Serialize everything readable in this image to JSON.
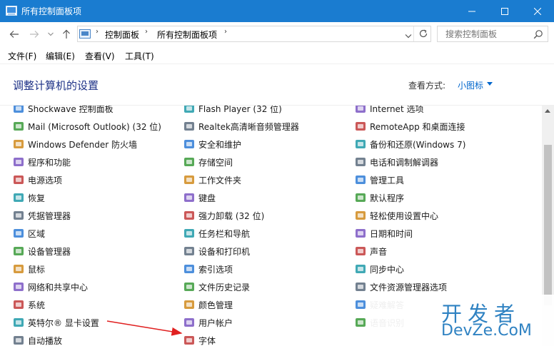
{
  "window": {
    "title": "所有控制面板项",
    "minimize_glyph": "—",
    "maximize_glyph": "☐",
    "close_glyph": "✕"
  },
  "address": {
    "crumbs": [
      "控制面板",
      "所有控制面板项"
    ],
    "separator": "›",
    "dropdown_glyph": "⌄",
    "refresh_glyph": "↻"
  },
  "search": {
    "placeholder": "搜索控制面板"
  },
  "menu": {
    "file": "文件(F)",
    "edit": "编辑(E)",
    "view": "查看(V)",
    "tools": "工具(T)"
  },
  "heading": "调整计算机的设置",
  "view_by": {
    "label": "查看方式:",
    "value": "小图标"
  },
  "columns": [
    {
      "items": [
        {
          "label": "Shockwave 控制面板",
          "icon": "shockwave-icon",
          "partial": true
        },
        {
          "label": "Mail (Microsoft Outlook) (32 位)",
          "icon": "mail-icon"
        },
        {
          "label": "Windows Defender 防火墙",
          "icon": "firewall-icon"
        },
        {
          "label": "程序和功能",
          "icon": "programs-icon"
        },
        {
          "label": "电源选项",
          "icon": "power-icon"
        },
        {
          "label": "恢复",
          "icon": "recovery-icon"
        },
        {
          "label": "凭据管理器",
          "icon": "credential-icon"
        },
        {
          "label": "区域",
          "icon": "region-icon"
        },
        {
          "label": "设备管理器",
          "icon": "device-manager-icon"
        },
        {
          "label": "鼠标",
          "icon": "mouse-icon"
        },
        {
          "label": "网络和共享中心",
          "icon": "network-icon"
        },
        {
          "label": "系统",
          "icon": "system-icon"
        },
        {
          "label": "英特尔® 显卡设置",
          "icon": "intel-graphics-icon"
        },
        {
          "label": "自动播放",
          "icon": "autoplay-icon"
        }
      ]
    },
    {
      "items": [
        {
          "label": "Flash Player (32 位)",
          "icon": "flash-icon",
          "partial": true
        },
        {
          "label": "Realtek高清晰音频管理器",
          "icon": "realtek-icon"
        },
        {
          "label": "安全和维护",
          "icon": "security-flag-icon"
        },
        {
          "label": "存储空间",
          "icon": "storage-icon"
        },
        {
          "label": "工作文件夹",
          "icon": "work-folders-icon"
        },
        {
          "label": "键盘",
          "icon": "keyboard-icon"
        },
        {
          "label": "强力卸载 (32 位)",
          "icon": "uninstall-icon"
        },
        {
          "label": "任务栏和导航",
          "icon": "taskbar-icon"
        },
        {
          "label": "设备和打印机",
          "icon": "printer-icon"
        },
        {
          "label": "索引选项",
          "icon": "indexing-icon"
        },
        {
          "label": "文件历史记录",
          "icon": "file-history-icon"
        },
        {
          "label": "颜色管理",
          "icon": "color-management-icon"
        },
        {
          "label": "用户帐户",
          "icon": "user-accounts-icon"
        },
        {
          "label": "字体",
          "icon": "fonts-icon"
        }
      ]
    },
    {
      "items": [
        {
          "label": "Internet 选项",
          "icon": "internet-options-icon",
          "partial": true
        },
        {
          "label": "RemoteApp 和桌面连接",
          "icon": "remoteapp-icon"
        },
        {
          "label": "备份和还原(Windows 7)",
          "icon": "backup-icon"
        },
        {
          "label": "电话和调制解调器",
          "icon": "phone-modem-icon"
        },
        {
          "label": "管理工具",
          "icon": "admin-tools-icon"
        },
        {
          "label": "默认程序",
          "icon": "default-programs-icon"
        },
        {
          "label": "轻松使用设置中心",
          "icon": "ease-of-access-icon"
        },
        {
          "label": "日期和时间",
          "icon": "datetime-icon"
        },
        {
          "label": "声音",
          "icon": "sound-icon"
        },
        {
          "label": "同步中心",
          "icon": "sync-icon"
        },
        {
          "label": "文件资源管理器选项",
          "icon": "folder-options-icon"
        },
        {
          "label": "疑难解答",
          "icon": "troubleshoot-icon"
        },
        {
          "label": "语音识别",
          "icon": "speech-icon"
        }
      ]
    }
  ],
  "watermark": {
    "top": "开发者",
    "bottom": "DevZe.CoM"
  },
  "colors": {
    "titlebar": "#1a7cd0",
    "heading": "#1e3287",
    "link": "#0066cc",
    "arrow": "#e02020",
    "watermark": "#2f82c2"
  }
}
